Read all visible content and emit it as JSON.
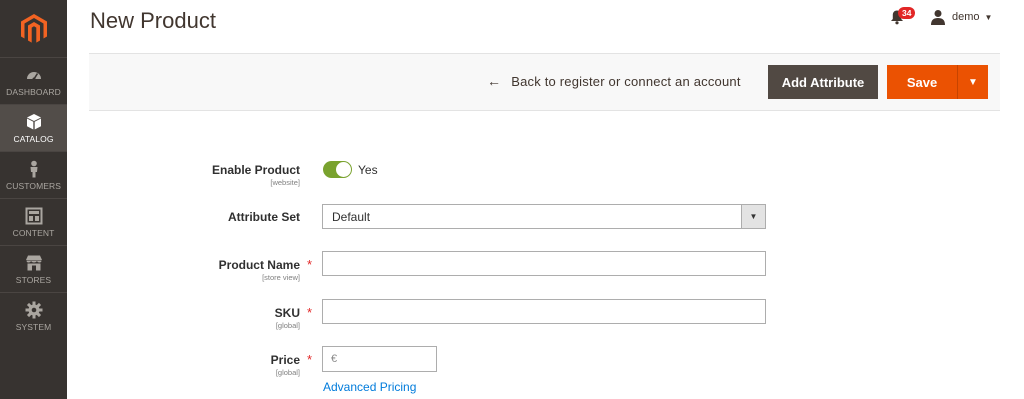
{
  "sidebar": {
    "items": [
      {
        "label": "Dashboard",
        "icon": "dashboard-icon"
      },
      {
        "label": "Catalog",
        "icon": "catalog-icon",
        "active": true
      },
      {
        "label": "Customers",
        "icon": "customers-icon"
      },
      {
        "label": "Content",
        "icon": "content-icon"
      },
      {
        "label": "Stores",
        "icon": "stores-icon"
      },
      {
        "label": "System",
        "icon": "system-icon"
      }
    ]
  },
  "header": {
    "title": "New Product",
    "notifications_count": "34",
    "user_name": "demo"
  },
  "actions": {
    "back_label": "Back to register or connect an account",
    "add_attribute_label": "Add Attribute",
    "save_label": "Save"
  },
  "form": {
    "enable_product": {
      "label": "Enable Product",
      "scope": "[website]",
      "value": "Yes",
      "checked": true
    },
    "attribute_set": {
      "label": "Attribute Set",
      "value": "Default"
    },
    "product_name": {
      "label": "Product Name",
      "scope": "[store view]",
      "value": "",
      "required": "*"
    },
    "sku": {
      "label": "SKU",
      "scope": "[global]",
      "value": "",
      "required": "*"
    },
    "price": {
      "label": "Price",
      "scope": "[global]",
      "currency": "€",
      "value": "",
      "required": "*"
    },
    "advanced_pricing_label": "Advanced Pricing"
  },
  "colors": {
    "sidebar_bg": "#373330",
    "accent": "#eb5202",
    "toggle_on": "#79a22e",
    "link": "#007bdb"
  }
}
